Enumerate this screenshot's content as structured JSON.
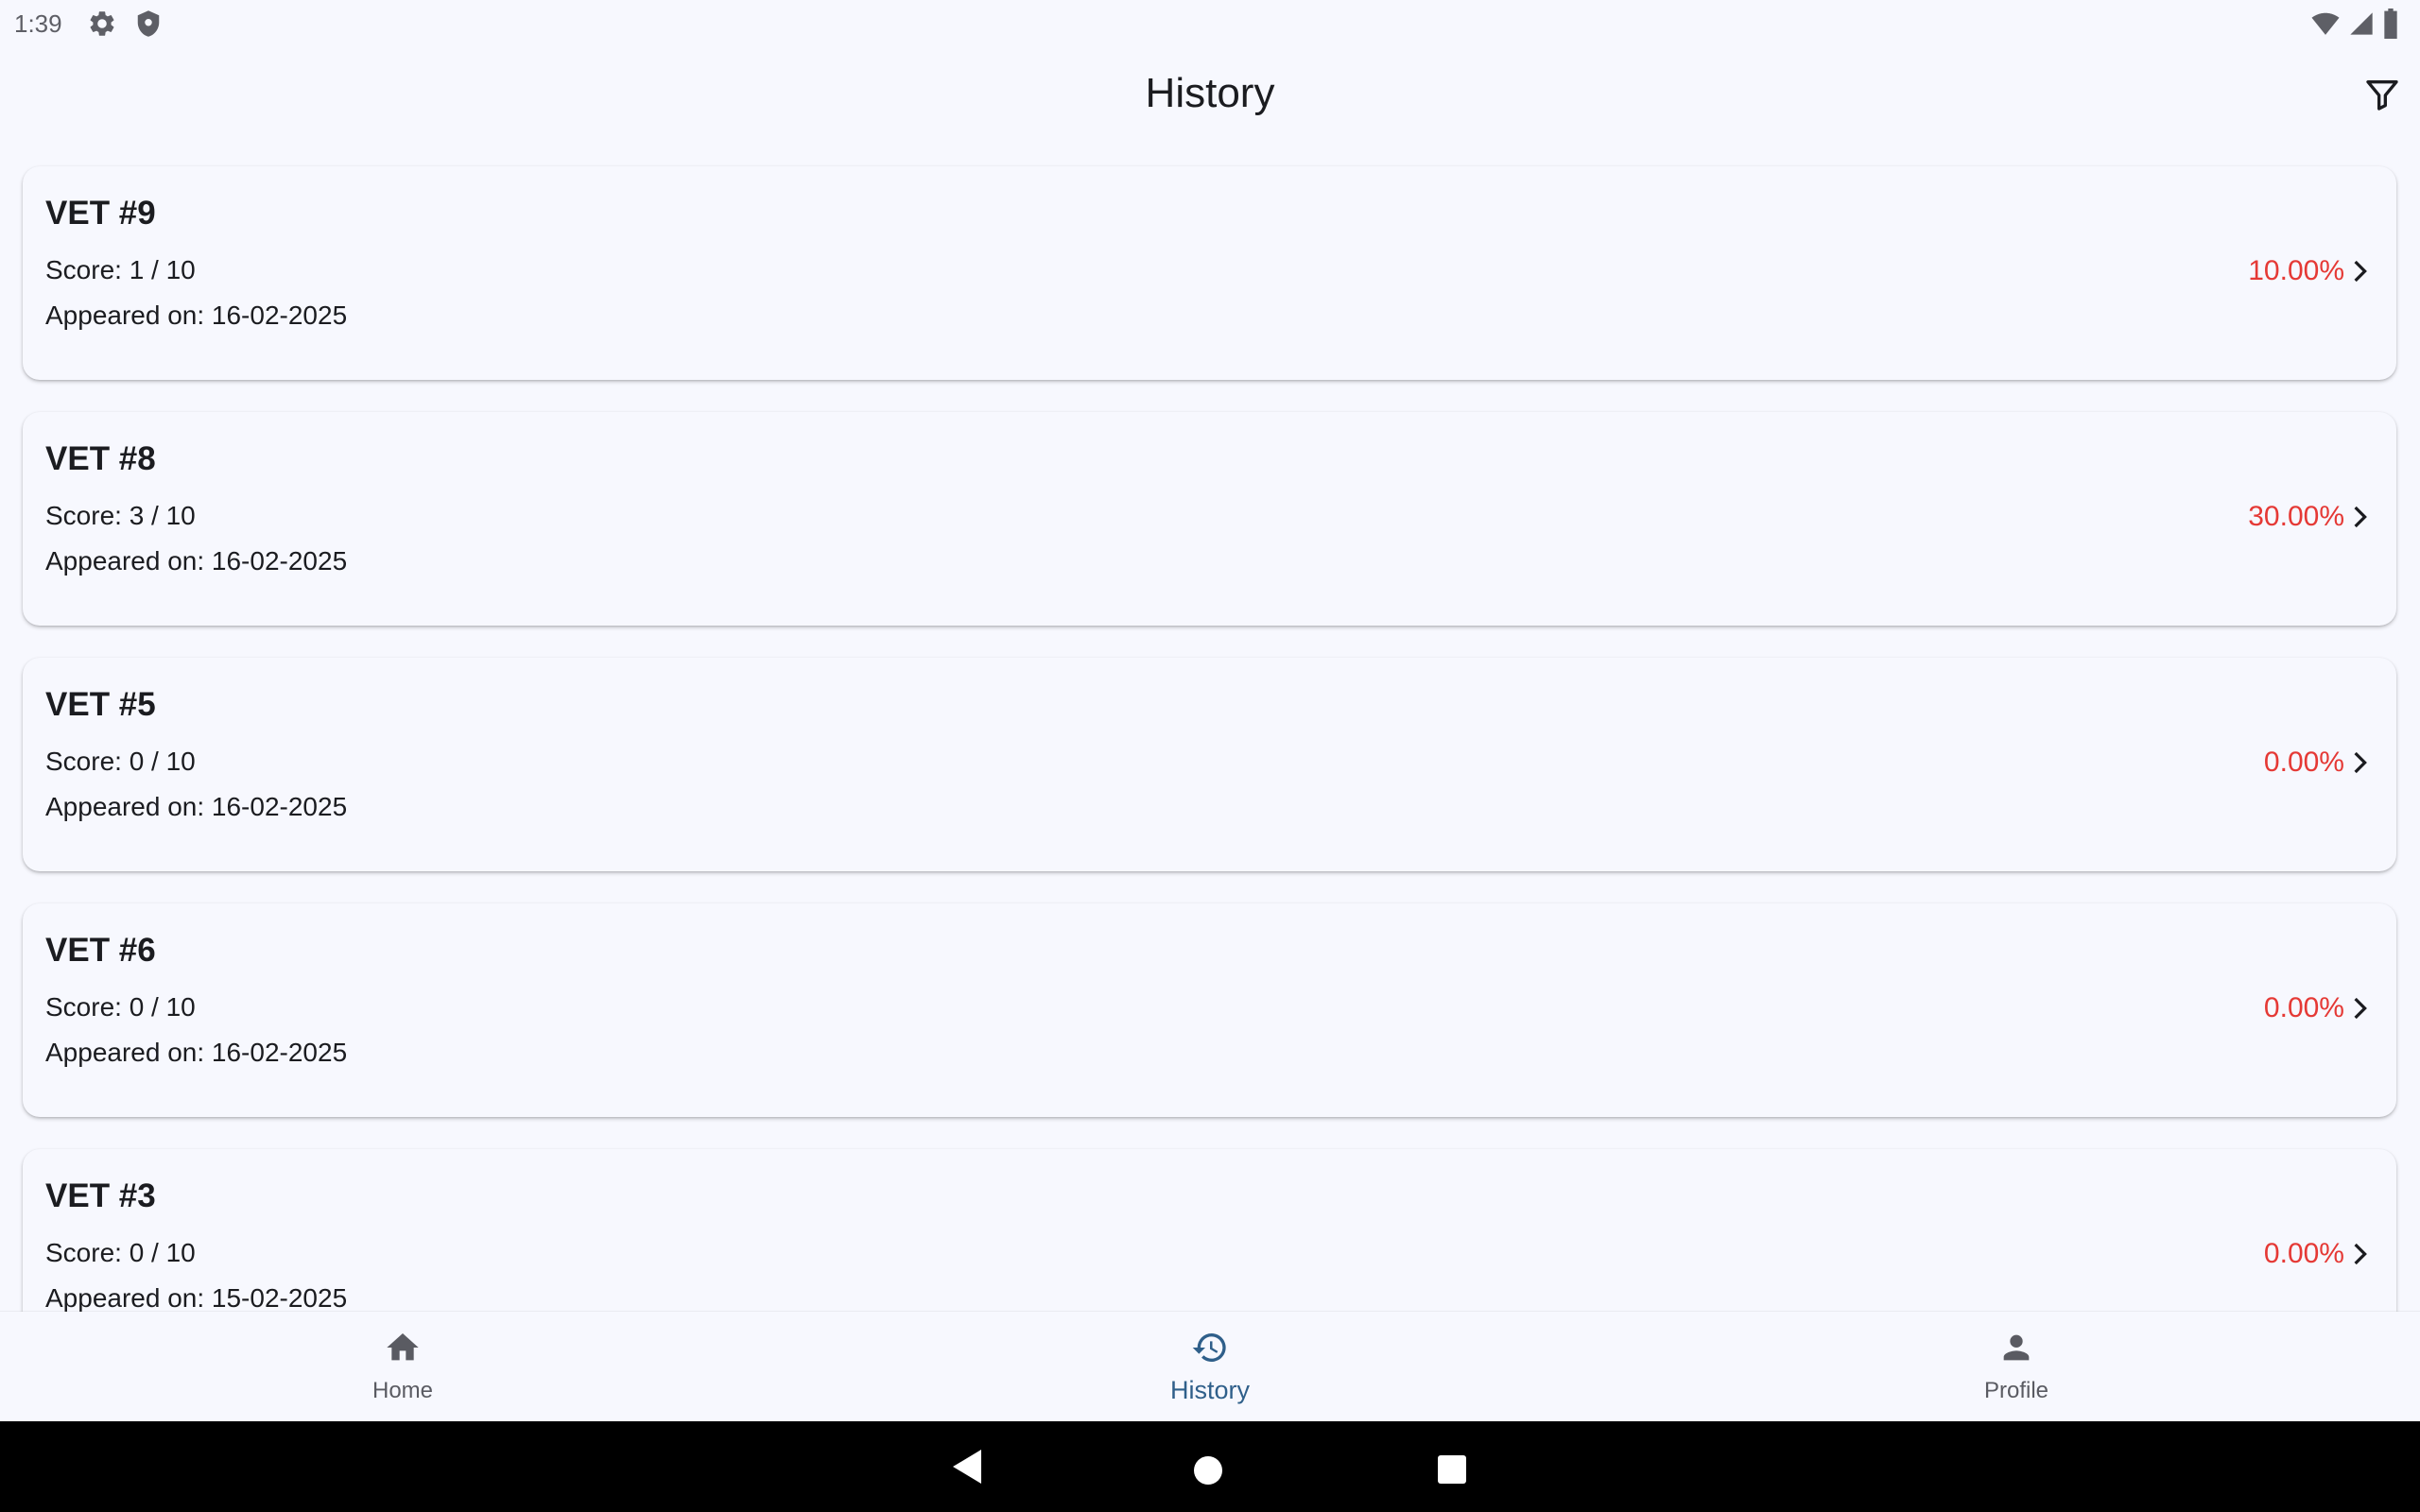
{
  "status_bar": {
    "time": "1:39",
    "left_icons": [
      "gear-icon",
      "shield-icon"
    ],
    "right_icons": [
      "wifi-icon",
      "signal-icon",
      "battery-icon"
    ]
  },
  "app_bar": {
    "title": "History",
    "action_icon": "filter-icon"
  },
  "history": {
    "items": [
      {
        "title": "VET #9",
        "score": "Score: 1 / 10",
        "date": "Appeared on: 16-02-2025",
        "percent": "10.00%"
      },
      {
        "title": "VET #8",
        "score": "Score: 3 / 10",
        "date": "Appeared on: 16-02-2025",
        "percent": "30.00%"
      },
      {
        "title": "VET #5",
        "score": "Score: 0 / 10",
        "date": "Appeared on: 16-02-2025",
        "percent": "0.00%"
      },
      {
        "title": "VET #6",
        "score": "Score: 0 / 10",
        "date": "Appeared on: 16-02-2025",
        "percent": "0.00%"
      },
      {
        "title": "VET #3",
        "score": "Score: 0 / 10",
        "date": "Appeared on: 15-02-2025",
        "percent": "0.00%"
      }
    ]
  },
  "bottom_nav": {
    "items": [
      {
        "label": "Home",
        "icon": "home-icon",
        "active": false
      },
      {
        "label": "History",
        "icon": "history-icon",
        "active": true
      },
      {
        "label": "Profile",
        "icon": "person-icon",
        "active": false
      }
    ]
  },
  "system_nav": [
    "back-icon",
    "home-circle-icon",
    "recents-icon"
  ],
  "colors": {
    "background": "#f7f8fe",
    "percent_red": "#e53935",
    "nav_active": "#2f5f8a",
    "nav_inactive": "#5a5b62"
  }
}
